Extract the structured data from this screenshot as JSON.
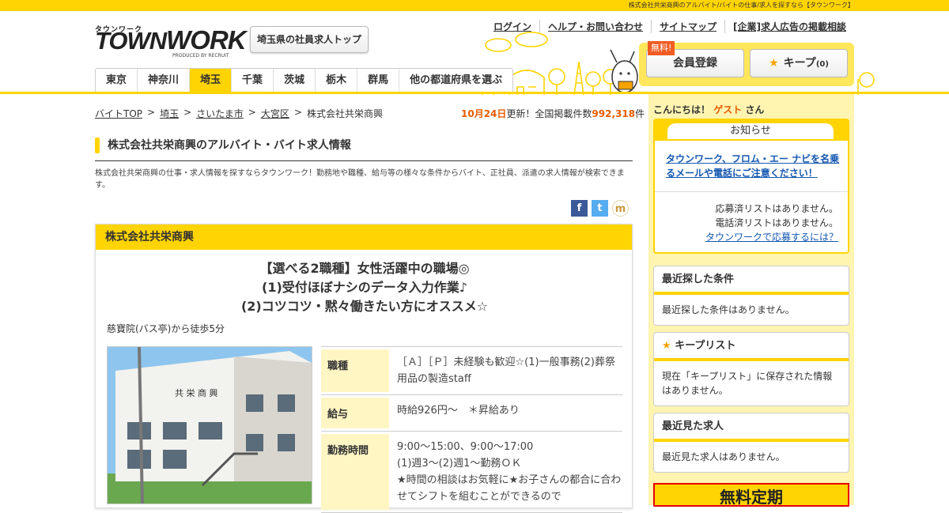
{
  "page_title_bar": "株式会社共栄商興のアルバイト/バイトの仕事/求人を探すなら【タウンワーク】",
  "logo": {
    "kana": "タウンワーク",
    "word": "TOWNWORK",
    "produced": "PRODUCED BY RECRUIT"
  },
  "pref_top_button": "埼玉県の社員求人トップ",
  "header_nav": [
    "ログイン",
    "ヘルプ・お問い合わせ",
    "サイトマップ",
    "[企業]求人広告の掲載相談"
  ],
  "tabs": [
    "東京",
    "神奈川",
    "埼玉",
    "千葉",
    "茨城",
    "栃木",
    "群馬",
    "他の都道府県を選ぶ"
  ],
  "member": {
    "free_badge": "無料!",
    "register": "会員登録",
    "keep": "キープ",
    "keep_count": "(0)"
  },
  "breadcrumb": [
    "バイトTOP",
    "埼玉",
    "さいたま市",
    "大宮区",
    "株式会社共栄商興"
  ],
  "update": {
    "date": "10月24日",
    "mid": "更新！全国掲載件数",
    "count": "992,318",
    "unit": "件"
  },
  "heading": "株式会社共栄商興のアルバイト・バイト求人情報",
  "description": "株式会社共栄商興の仕事・求人情報を探すならタウンワーク！勤務地や職種、給与等の様々な条件からバイト、正社員、派遣の求人情報が検索できます。",
  "card": {
    "company": "株式会社共栄商興",
    "catch": [
      "【選べる2職種】女性活躍中の職場◎",
      "(1)受付ほぼナシのデータ入力作業♪",
      "(2)コツコツ・黙々働きたい方にオススメ☆"
    ],
    "access": "慈寶院(バス亭)から徒歩5分",
    "photo_sign": "共 栄 商 興",
    "rows": [
      {
        "k": "職種",
        "v": "［Ａ］［Ｐ］未経験も歓迎☆(1)一般事務(2)葬祭用品の製造staff"
      },
      {
        "k": "給与",
        "v": "時給926円～　＊昇給あり"
      },
      {
        "k": "勤務時間",
        "v": "9:00～15:00、9:00～17:00\n(1)週3～(2)週1～勤務ＯＫ\n★時間の相談はお気軽に★お子さんの都合に合わせてシフトを組むことができるので"
      }
    ]
  },
  "sidebar": {
    "greet_pre": "こんにちは！",
    "greet_name": "ゲスト",
    "greet_post": "さん",
    "notice_title": "お知らせ",
    "notice_link": "タウンワーク、フロム・エー ナビを名乗るメールや電話にご注意ください！",
    "notice_lines": [
      "応募済リストはありません。",
      "電話済リストはありません。"
    ],
    "notice_apply_link": "タウンワークで応募するには？",
    "recent_cond_title": "最近探した条件",
    "recent_cond_body": "最近探した条件はありません。",
    "keep_title": "キープリスト",
    "keep_body": "現在「キープリスト」に保存された情報はありません。",
    "recent_view_title": "最近見た求人",
    "recent_view_body": "最近見た求人はありません。",
    "banner": "無料定期"
  },
  "colors": {
    "brand_yellow": "#ffd400",
    "accent_orange": "#e65c00",
    "link_blue": "#1558b0"
  }
}
